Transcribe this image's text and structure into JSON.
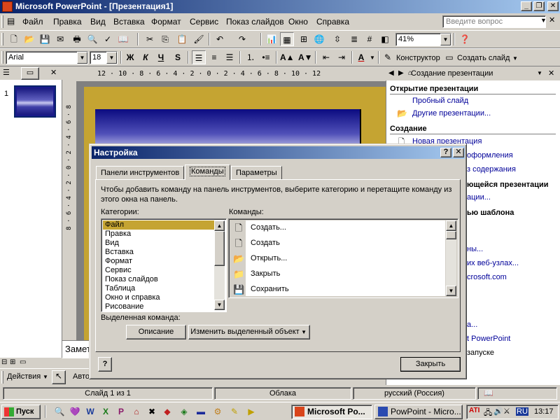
{
  "window": {
    "title": "Microsoft PowerPoint - [Презентация1]"
  },
  "menu": {
    "items": [
      "Файл",
      "Правка",
      "Вид",
      "Вставка",
      "Формат",
      "Сервис",
      "Показ слайдов",
      "Окно",
      "Справка"
    ],
    "help_placeholder": "Введите вопрос"
  },
  "toolbar": {
    "zoom": "41%",
    "font": "Arial",
    "size": "18",
    "designer": "Конструктор",
    "new_slide": "Создать слайд"
  },
  "left_pane": {
    "slide_number": "1"
  },
  "ruler": {
    "h": "12 · 10 · 8 · 6 · 4 · 2 · 0 · 2 · 4 · 6 · 8 · 10 · 12",
    "v": "8 · 6 · 4 · 2 · 0 · 2 · 4 · 6 · 8"
  },
  "notes": {
    "label": "Замет"
  },
  "task_pane": {
    "title": "Создание презентации",
    "open_heading": "Открытие презентации",
    "sample_slide": "Пробный слайд",
    "other_presentations": "Другие презентации...",
    "create_heading": "Создание",
    "new_presentation": "Новая презентация",
    "design_partial": "оформления",
    "content_partial": "з содержания",
    "existing_heading_partial": "ющейся презентации",
    "existing_link_partial": "ации...",
    "template_heading_partial": "ью шаблона",
    "templates_partial": "ны...",
    "websites_partial": "их веб-узлах...",
    "ms_partial": "crosoft.com",
    "add_partial": "а...",
    "help_partial": "t PowerPoint",
    "startup_partial": "запуске"
  },
  "dialog": {
    "title": "Настройка",
    "tabs": [
      "Панели инструментов",
      "Команды",
      "Параметры"
    ],
    "instruction": "Чтобы добавить команду на панель инструментов, выберите категорию и перетащите команду из этого окна на панель.",
    "categories_label": "Категории:",
    "commands_label": "Команды:",
    "categories": [
      "Файл",
      "Правка",
      "Вид",
      "Вставка",
      "Формат",
      "Сервис",
      "Показ слайдов",
      "Таблица",
      "Окно и справка",
      "Рисование"
    ],
    "commands": [
      {
        "icon": "new-document-icon",
        "label": "Создать..."
      },
      {
        "icon": "new-document-icon",
        "label": "Создать"
      },
      {
        "icon": "open-folder-icon",
        "label": "Открыть..."
      },
      {
        "icon": "close-folder-icon",
        "label": "Закрыть"
      },
      {
        "icon": "floppy-disk-icon",
        "label": "Сохранить"
      }
    ],
    "selected_command_label": "Выделенная команда:",
    "description_button": "Описание",
    "modify_button": "Изменить выделенный объект",
    "close_button": "Закрыть",
    "help_button": "?"
  },
  "drawing_bar": {
    "actions": "Действия",
    "auto": "Авто"
  },
  "status": {
    "slide": "Слайд 1 из 1",
    "design": "Облака",
    "language": "русский (Россия)"
  },
  "taskbar": {
    "start": "Пуск",
    "tasks": [
      "Microsoft Po...",
      "PowPoint - Micro..."
    ],
    "lang": "RU",
    "clock": "13:17"
  },
  "colors": {
    "title_start": "#0a246a",
    "title_end": "#a6caf0",
    "face": "#d4d0c8",
    "selection": "#c5a432",
    "link": "#000099"
  }
}
